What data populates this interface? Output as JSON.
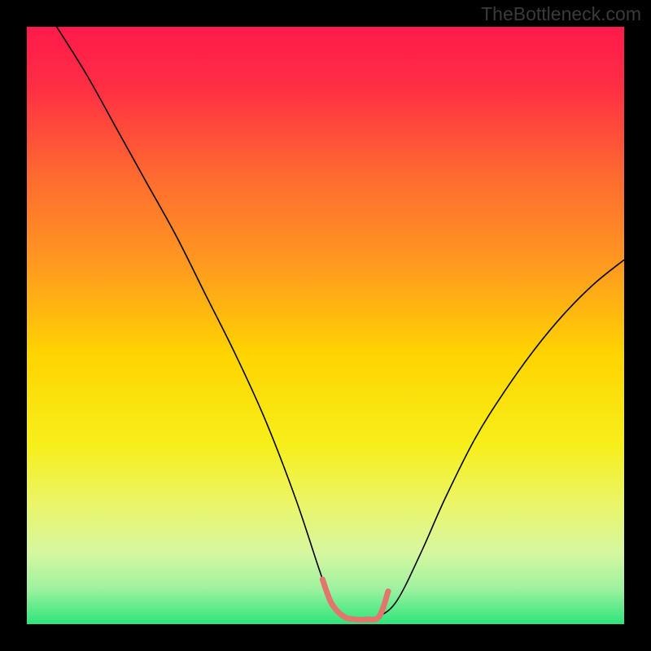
{
  "watermark": "TheBottleneck.com",
  "chart_data": {
    "type": "line",
    "title": "",
    "xlabel": "",
    "ylabel": "",
    "xlim": [
      0,
      100
    ],
    "ylim": [
      0,
      100
    ],
    "grid": false,
    "legend": false,
    "background_gradient": {
      "stops": [
        {
          "offset": 0.0,
          "color": "#ff1a4b"
        },
        {
          "offset": 0.1,
          "color": "#ff2e44"
        },
        {
          "offset": 0.25,
          "color": "#ff6a30"
        },
        {
          "offset": 0.4,
          "color": "#ff9a20"
        },
        {
          "offset": 0.55,
          "color": "#ffd400"
        },
        {
          "offset": 0.7,
          "color": "#f7ef1a"
        },
        {
          "offset": 0.8,
          "color": "#eaf56a"
        },
        {
          "offset": 0.88,
          "color": "#d6f7a0"
        },
        {
          "offset": 0.94,
          "color": "#9ff2a0"
        },
        {
          "offset": 1.0,
          "color": "#2de57a"
        }
      ]
    },
    "series": [
      {
        "name": "bottleneck-curve",
        "stroke": "#000000",
        "stroke_width": 1.6,
        "x": [
          5,
          10,
          15,
          20,
          25,
          30,
          35,
          40,
          45,
          49,
          51,
          53,
          55,
          57,
          59,
          62,
          66,
          70,
          75,
          80,
          85,
          90,
          95,
          100
        ],
        "y": [
          100,
          92,
          83,
          74,
          65,
          55,
          45,
          34,
          21,
          9,
          3.5,
          1.3,
          0.8,
          0.8,
          1.3,
          4,
          12,
          21,
          31,
          39,
          46,
          52,
          57,
          61
        ]
      },
      {
        "name": "valley-highlight",
        "stroke": "#e2756d",
        "stroke_width": 7,
        "linecap": "round",
        "x": [
          49.5,
          51,
          53,
          55,
          57,
          59,
          60.5
        ],
        "y": [
          7.5,
          3.5,
          1.3,
          0.8,
          0.8,
          1.3,
          5.5
        ]
      }
    ]
  }
}
